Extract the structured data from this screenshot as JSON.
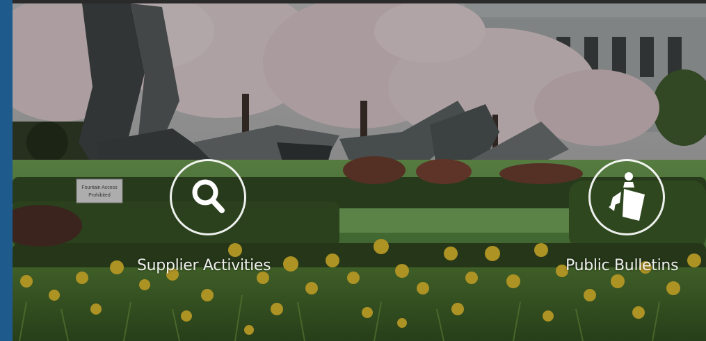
{
  "tiles": [
    {
      "id": "supplier-activities",
      "label": "Supplier Activities",
      "icon": "search-icon"
    },
    {
      "id": "public-bulletins",
      "label": "Public Bulletins",
      "icon": "bulletin-bag-icon"
    }
  ],
  "scene": {
    "sign_text": "Fountain Access Prohibited"
  },
  "colors": {
    "frame_blue": "#1f5a8c",
    "icon_white": "#ffffff"
  }
}
